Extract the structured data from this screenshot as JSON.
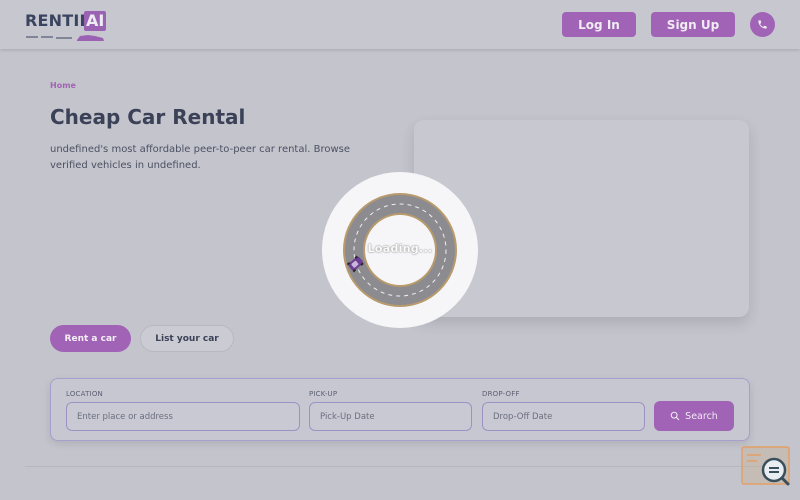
{
  "header": {
    "logo_text": "RENTIF",
    "logo_ai": "AI",
    "login_label": "Log In",
    "signup_label": "Sign Up",
    "phone_icon": "phone-icon"
  },
  "main": {
    "breadcrumb": "Home",
    "title": "Cheap Car Rental",
    "description": "undefined's most affordable peer-to-peer car rental. Browse verified vehicles in undefined.",
    "tabs": [
      {
        "label": "Rent a car",
        "active": true
      },
      {
        "label": "List your car",
        "active": false
      }
    ]
  },
  "search": {
    "location_label": "LOCATION",
    "location_placeholder": "Enter place or address",
    "pickup_label": "PICK-UP",
    "pickup_placeholder": "Pick-Up Date",
    "dropoff_label": "DROP-OFF",
    "dropoff_placeholder": "Drop-Off Date",
    "search_label": "Search",
    "search_icon": "search-icon"
  },
  "loader": {
    "text": "Loading...",
    "icon": "car-icon"
  },
  "colors": {
    "accent": "#a063b6",
    "title": "#3b4257",
    "overlay_bg": "#c4c4cd"
  }
}
